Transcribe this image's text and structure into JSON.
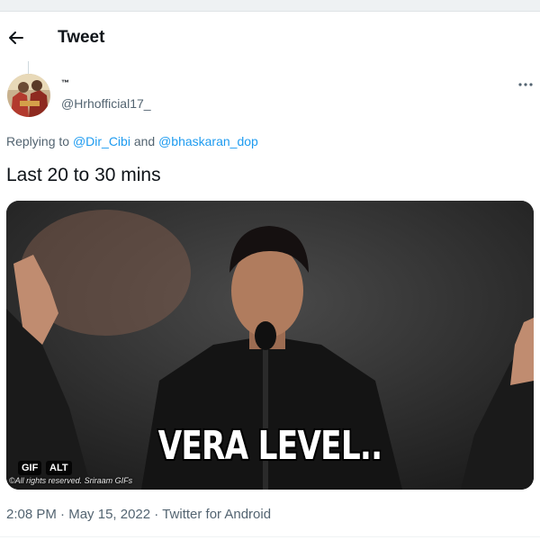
{
  "header": {
    "title": "Tweet",
    "back_icon": "back-arrow-icon"
  },
  "author": {
    "display_name": "™",
    "handle": "@Hrhofficial17_",
    "more_icon": "more-horizontal-icon"
  },
  "reply": {
    "prefix": "Replying to ",
    "mention_1": "@Dir_Cibi",
    "conjunction": " and ",
    "mention_2": "@bhaskaran_dop"
  },
  "tweet": {
    "text": "Last 20 to 30 mins"
  },
  "media": {
    "caption": "VERA LEVEL..",
    "gif_badge": "GIF",
    "alt_badge": "ALT",
    "watermark": "©All rights reserved. Sriraam GIFs"
  },
  "meta": {
    "time": "2:08 PM",
    "sep1": " · ",
    "date": "May 15, 2022",
    "sep2": " · ",
    "client": "Twitter for Android"
  },
  "colors": {
    "link": "#1d9bf0",
    "secondary_text": "#536471",
    "text": "#0f1419"
  }
}
